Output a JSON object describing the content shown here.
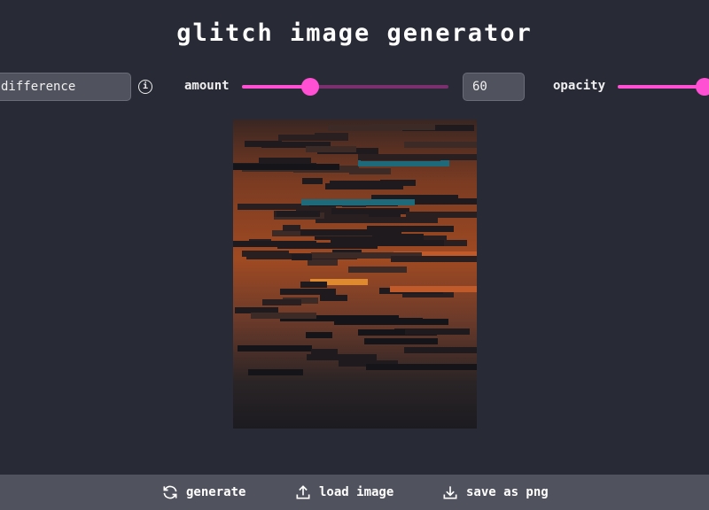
{
  "title": "glitch image generator",
  "controls": {
    "blend_mode": "difference",
    "info_icon": "info-icon",
    "amount_label": "amount",
    "amount_value": "60",
    "amount_slider_fraction": 0.33,
    "opacity_label": "opacity",
    "opacity_slider_fraction": 1.0
  },
  "colors": {
    "accent": "#ff4fd2",
    "background": "#282a36",
    "bar": "#50525e"
  },
  "toolbar": {
    "generate": "generate",
    "load": "load image",
    "save": "save as png"
  }
}
